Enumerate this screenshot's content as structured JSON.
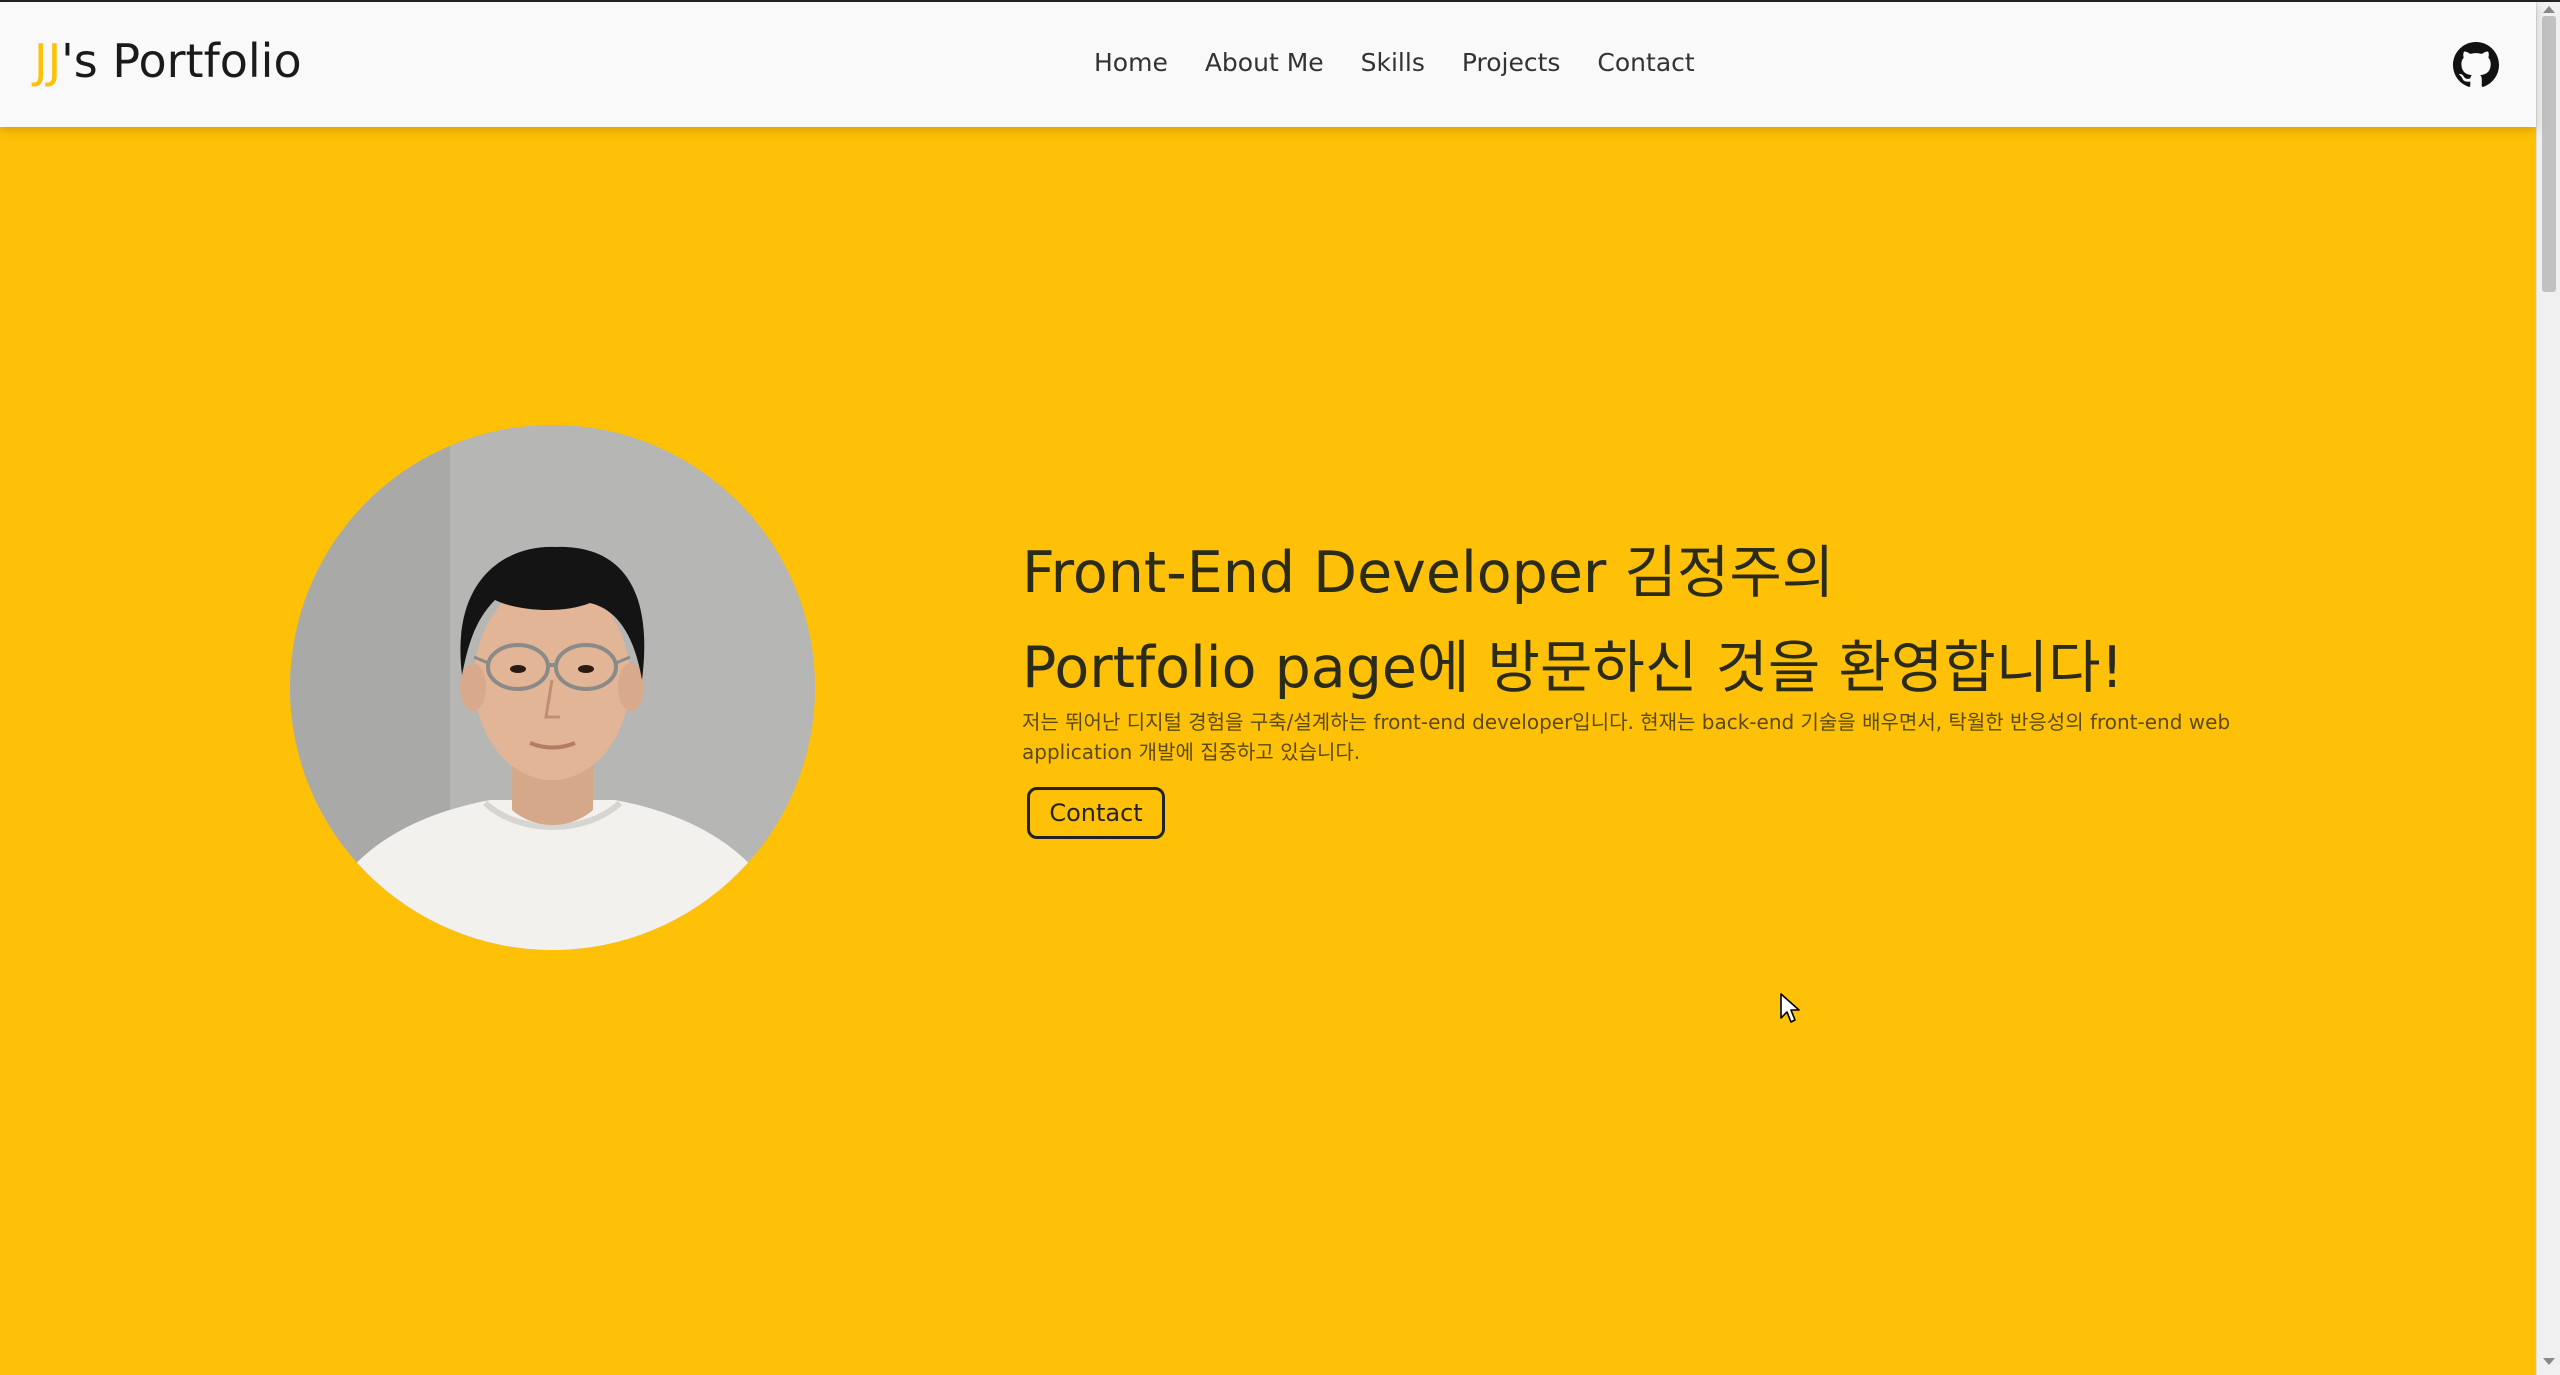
{
  "navbar": {
    "brand_accent": "JJ",
    "brand_rest": "'s Portfolio",
    "links": [
      "Home",
      "About Me",
      "Skills",
      "Projects",
      "Contact"
    ],
    "github_icon": "github-icon"
  },
  "hero": {
    "title_line1": "Front-End Developer 김정주의",
    "title_line2": "Portfolio page에 방문하신 것을 환영합니다!",
    "description": "저는 뛰어난 디지털 경험을 구축/설계하는 front-end developer입니다. 현재는 back-end 기술을 배우면서, 탁월한 반응성의 front-end web application 개발에 집중하고 있습니다.",
    "contact_button": "Contact"
  },
  "colors": {
    "accent": "#FFC107",
    "navbar_bg": "#f9f9f9",
    "text_dark": "#1a1a1a"
  }
}
